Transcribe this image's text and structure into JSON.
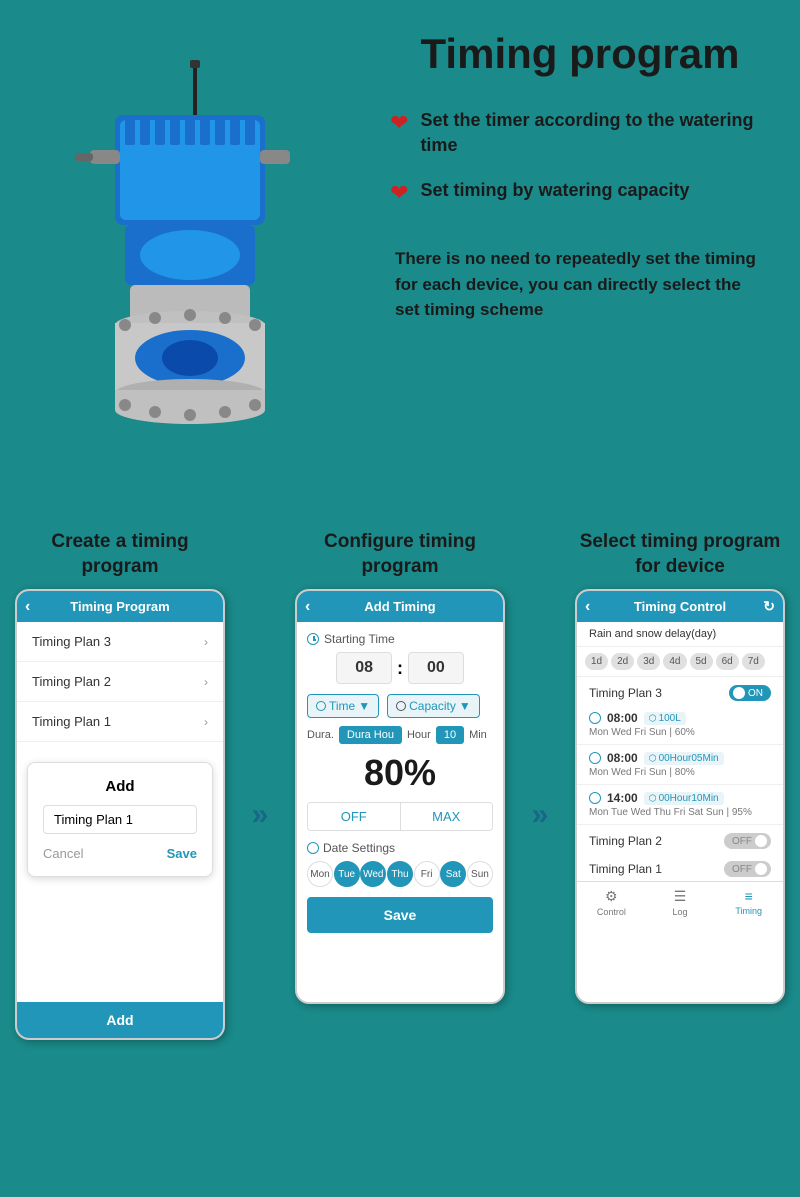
{
  "page": {
    "title": "Timing program",
    "bg_color": "#1a8a8a"
  },
  "top_right": {
    "bullet1": "Set the timer according to the watering time",
    "bullet2": "Set timing by watering capacity",
    "description": "There is no need to repeatedly set the timing for each device, you can directly select the set timing scheme"
  },
  "phones": {
    "phone1": {
      "label": "Create a timing program",
      "header": "Timing Program",
      "items": [
        "Timing Plan 3",
        "Timing Plan 2",
        "Timing Plan 1"
      ],
      "dialog_title": "Add",
      "dialog_input": "Timing Plan 1",
      "cancel_btn": "Cancel",
      "save_btn": "Save",
      "footer_btn": "Add"
    },
    "arrow1": "»",
    "phone2": {
      "label": "Configure timing program",
      "header": "Add Timing",
      "starting_time_label": "Starting Time",
      "hour": "08",
      "minute": "00",
      "mode1": "Time",
      "mode2": "Capacity",
      "dura_label": "Dura.",
      "hour_label": "Hour",
      "num_label": "10",
      "min_label": "Min",
      "percent": "80%",
      "off_label": "OFF",
      "max_label": "MAX",
      "date_settings": "Date Settings",
      "days": [
        "Mon",
        "Tue",
        "Wed",
        "Thu",
        "Fri",
        "Sat",
        "Sun"
      ],
      "active_days": [
        1,
        2,
        3,
        5
      ],
      "save_btn": "Save"
    },
    "arrow2": "»",
    "phone3": {
      "label": "Select timing program for device",
      "header": "Timing Control",
      "delay_label": "Rain and snow delay(day)",
      "day_tabs": [
        "1d",
        "2d",
        "3d",
        "4d",
        "5d",
        "6d",
        "7d"
      ],
      "plan3_label": "Timing Plan 3",
      "plan3_toggle": "ON",
      "entries": [
        {
          "time": "08:00",
          "extra": "100L",
          "days": "Mon Wed Fri Sun",
          "pct": "60%"
        },
        {
          "time": "08:00",
          "extra": "00Hour05Min",
          "days": "Mon Wed Fri Sun",
          "pct": "80%"
        },
        {
          "time": "14:00",
          "extra": "00Hour10Min",
          "days": "Mon Tue Wed Thu Fri Sat Sun",
          "pct": "95%"
        }
      ],
      "plan2_label": "Timing Plan 2",
      "plan2_toggle": "OFF",
      "plan1_label": "Timing Plan 1",
      "plan1_toggle": "OFF",
      "nav": [
        "Control",
        "Log",
        "Timing"
      ]
    }
  }
}
